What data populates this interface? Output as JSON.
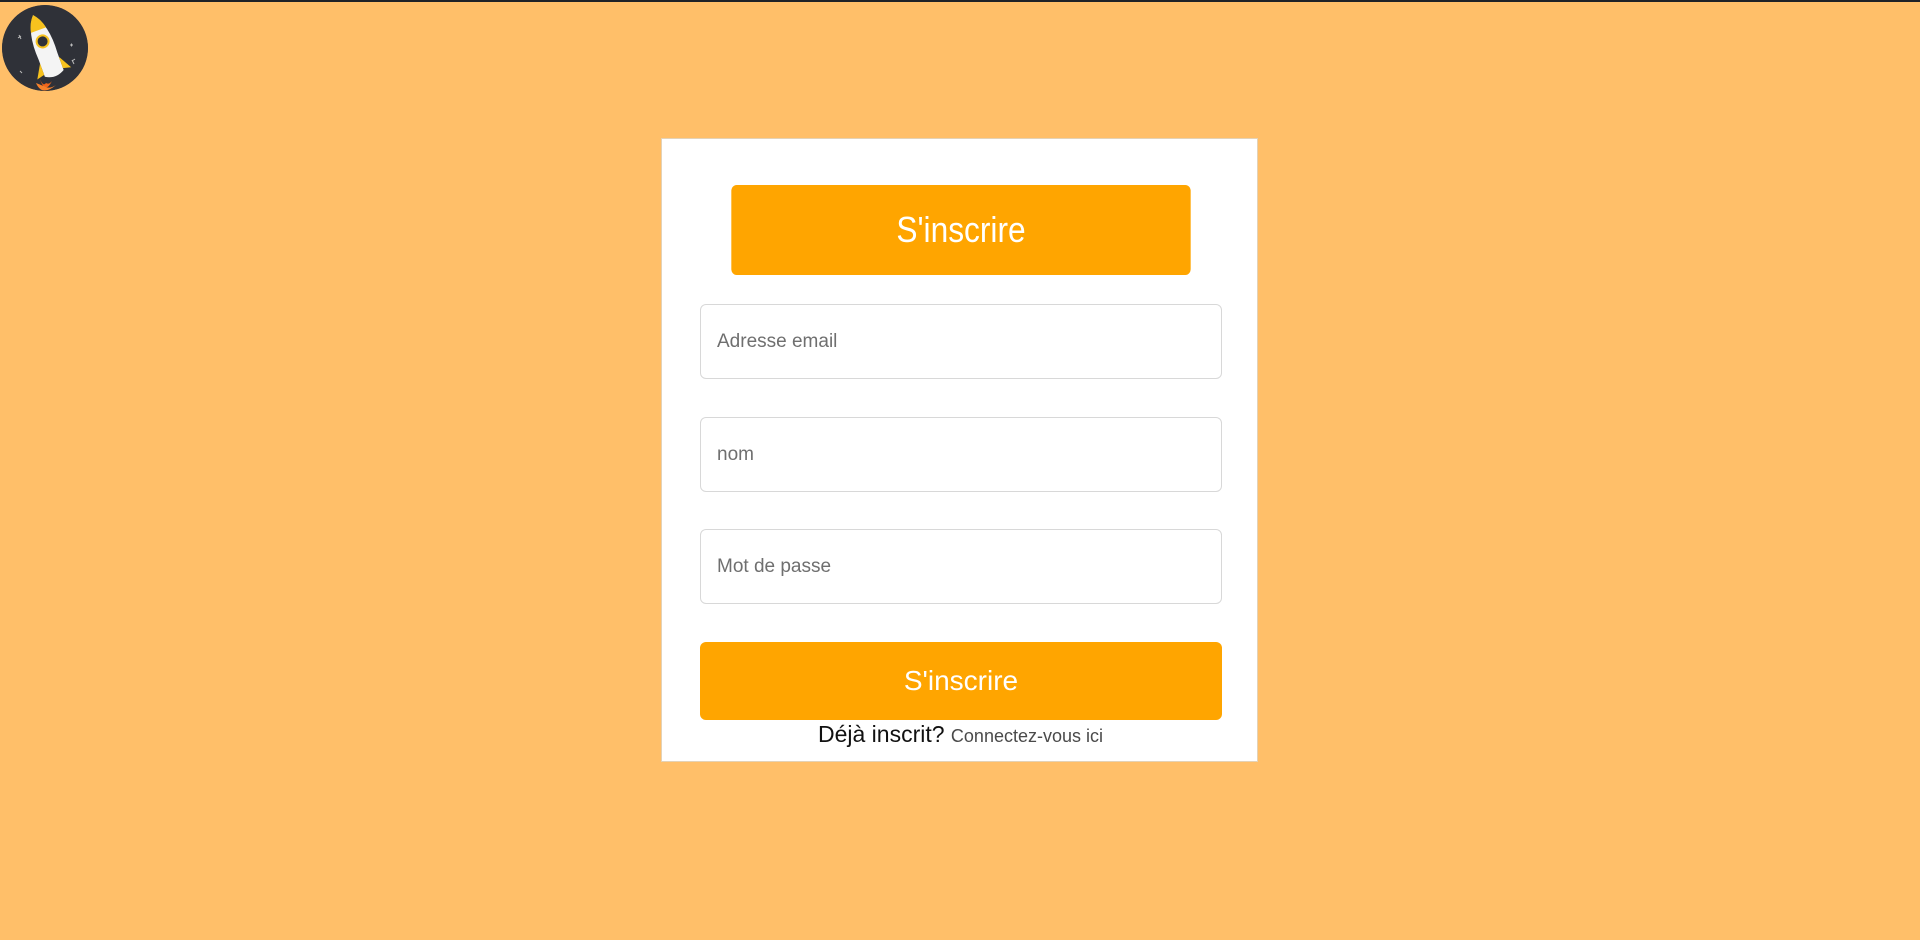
{
  "logo": {
    "icon": "rocket-icon",
    "accent": "#ffa500"
  },
  "signup": {
    "title": "S'inscrire",
    "fields": {
      "email_placeholder": "Adresse email",
      "name_placeholder": "nom",
      "password_placeholder": "Mot de passe"
    },
    "submit_label": "S'inscrire",
    "already_text": "Déjà inscrit?",
    "login_link": "Connectez-vous ici"
  },
  "colors": {
    "background": "#ffbf69",
    "accent": "#ffa500",
    "card": "#ffffff"
  }
}
